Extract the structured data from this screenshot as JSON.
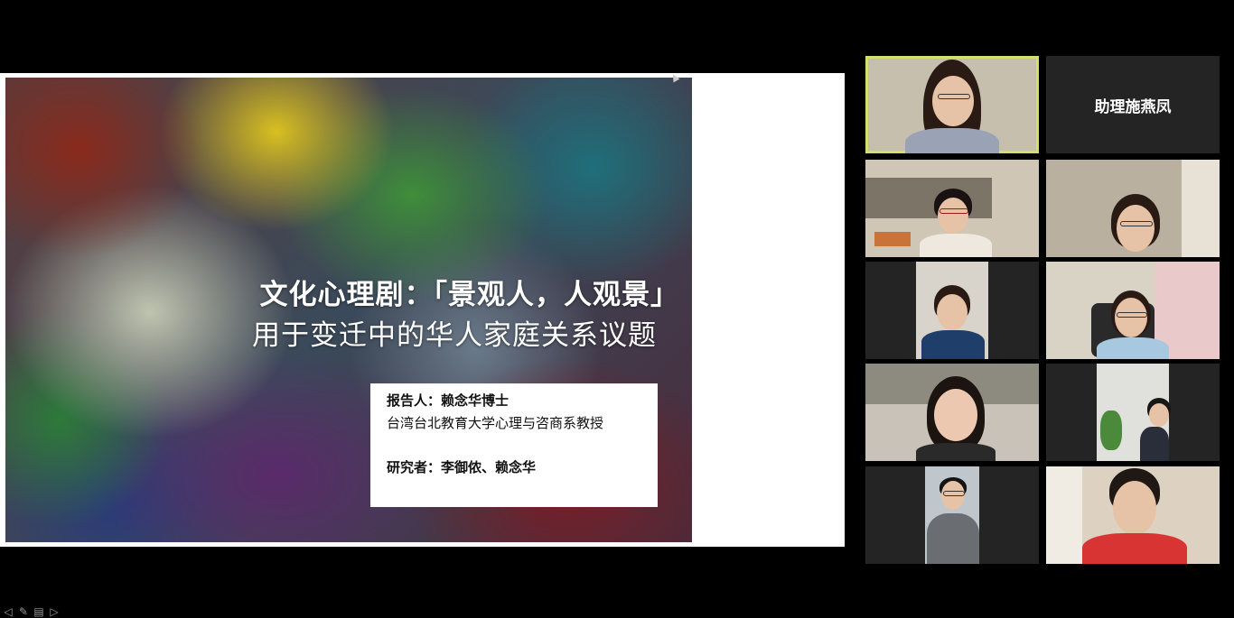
{
  "slide": {
    "title": "文化心理剧：「景观人，人观景」",
    "subtitle": "用于变迁中的华人家庭关系议题",
    "presenter": "报告人：赖念华博士",
    "affiliation": "台湾台北教育大学心理与咨商系教授",
    "researchers": "研究者：李御侬、赖念华"
  },
  "toolbar": {
    "icons": [
      "prev-icon",
      "pen-icon",
      "slides-icon",
      "next-icon"
    ],
    "glyphs": [
      "◁",
      "✎",
      "▤",
      "▷"
    ]
  },
  "participants": [
    {
      "id": "p1",
      "active": true,
      "bg": "#c7bfae"
    },
    {
      "id": "p2",
      "name": "助理施燕凤"
    },
    {
      "id": "p3",
      "bg": "#cfc6b6"
    },
    {
      "id": "p4",
      "bg": "#b9b0a0"
    },
    {
      "id": "p5",
      "bg": "#d8d4cc"
    },
    {
      "id": "p6",
      "bg": "#d9d3c6"
    },
    {
      "id": "p7",
      "bg": "#c8c2b8"
    },
    {
      "id": "p8",
      "bg": "#e0e0dc"
    },
    {
      "id": "p9",
      "bg": "#bfc7cc"
    },
    {
      "id": "p10",
      "bg": "#ddd2c2"
    }
  ],
  "colors": {
    "active_border": "#d2e06a",
    "tile_bg": "#242424"
  }
}
